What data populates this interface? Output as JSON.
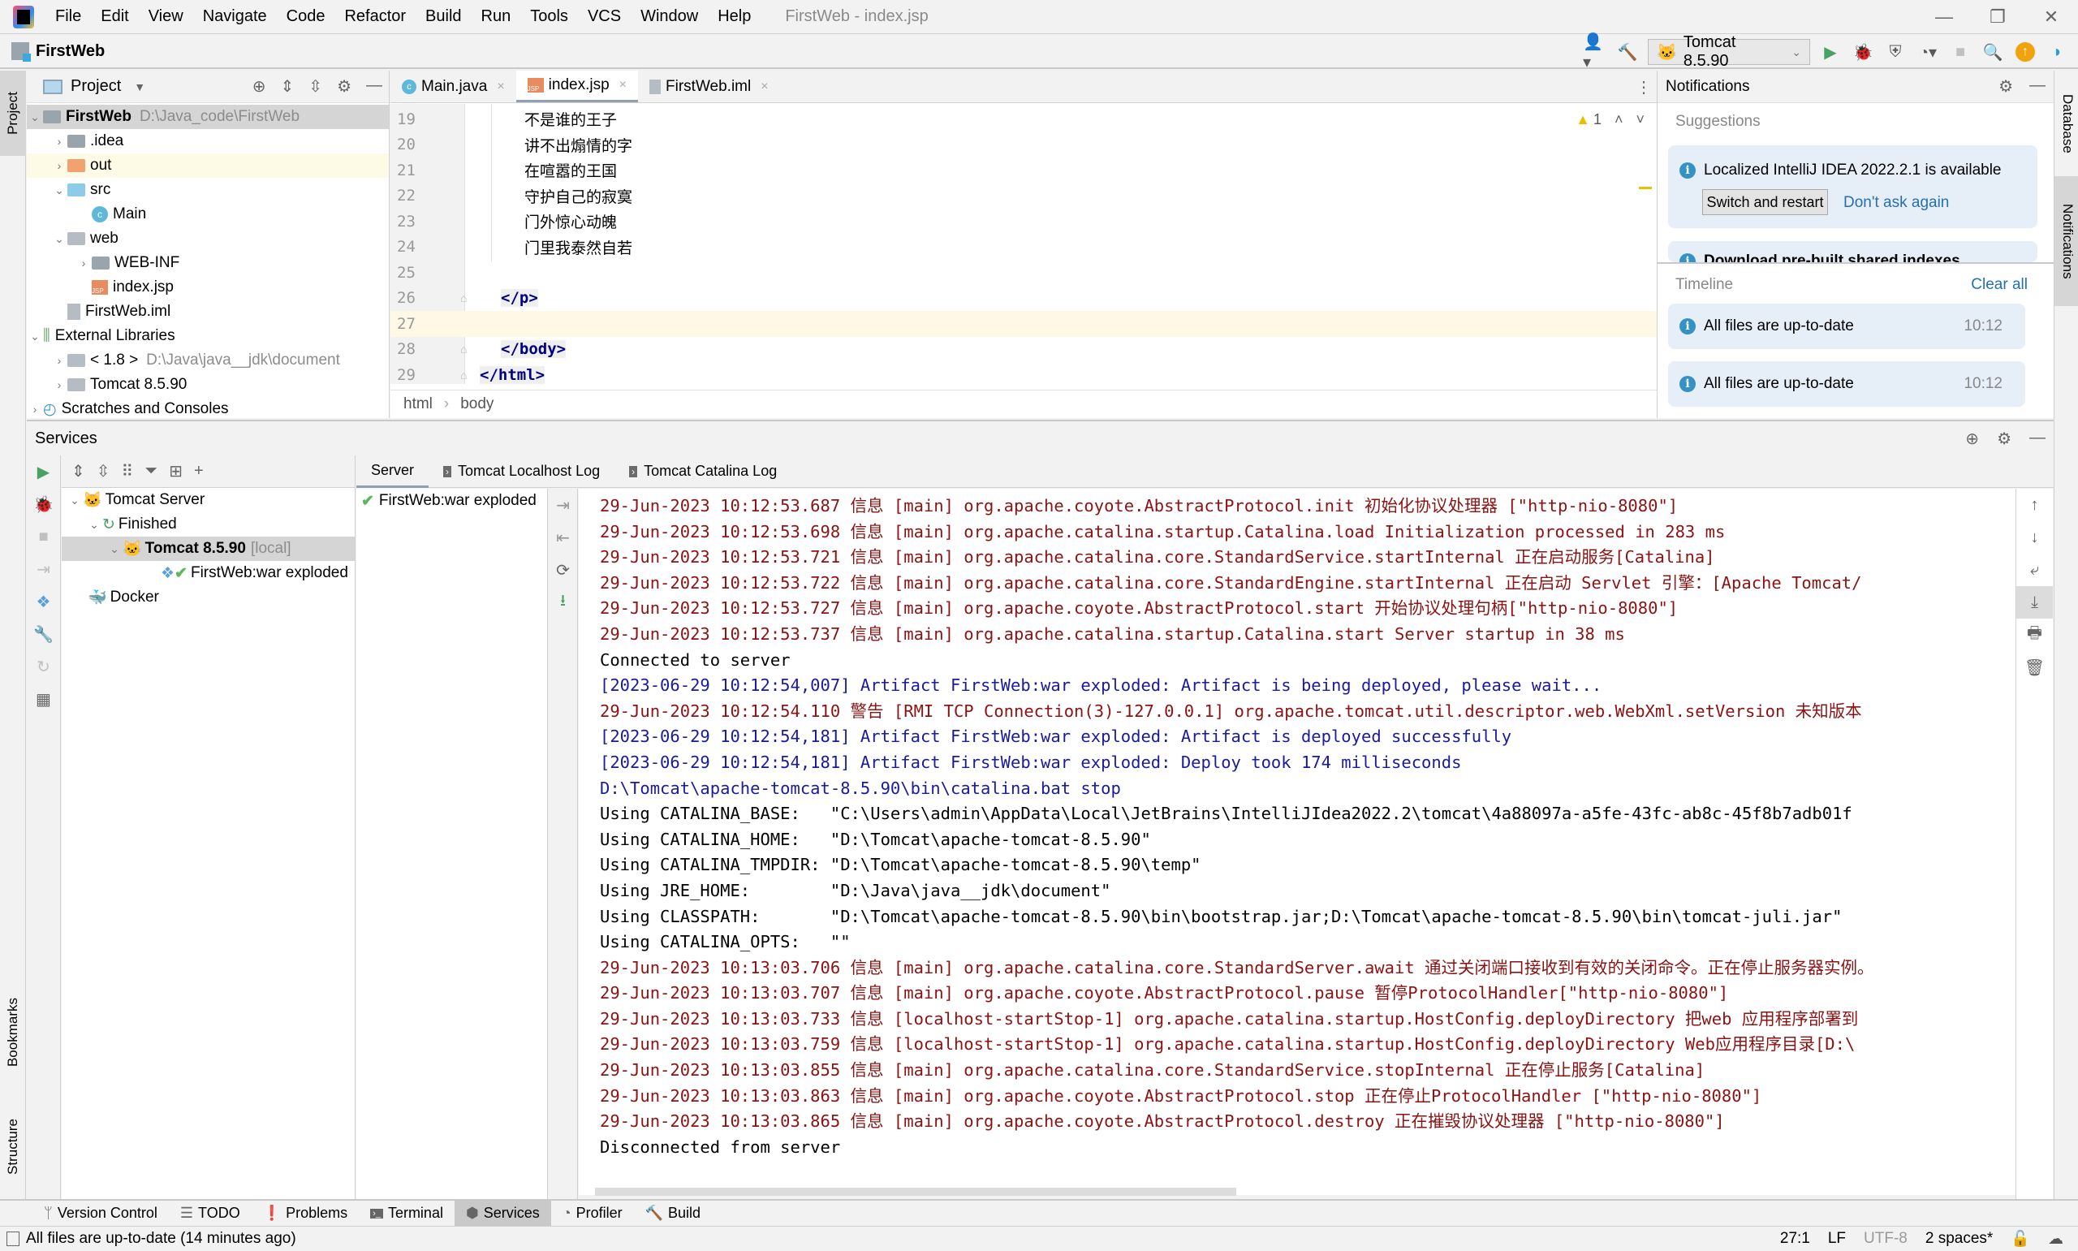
{
  "titlebar": {
    "menu": [
      "File",
      "Edit",
      "View",
      "Navigate",
      "Code",
      "Refactor",
      "Build",
      "Run",
      "Tools",
      "VCS",
      "Window",
      "Help"
    ],
    "window_title": "FirstWeb - index.jsp"
  },
  "navbar": {
    "project_name": "FirstWeb",
    "run_config": "Tomcat 8.5.90"
  },
  "left_stripe": {
    "project_tab": "Project",
    "bookmarks_tab": "Bookmarks",
    "structure_tab": "Structure"
  },
  "right_stripe": {
    "database_tab": "Database",
    "notifications_tab": "Notifications"
  },
  "project_panel": {
    "title": "Project",
    "tree": [
      {
        "label": "FirstWeb",
        "path": "D:\\Java_code\\FirstWeb"
      },
      {
        "label": ".idea"
      },
      {
        "label": "out"
      },
      {
        "label": "src"
      },
      {
        "label": "Main"
      },
      {
        "label": "web"
      },
      {
        "label": "WEB-INF"
      },
      {
        "label": "index.jsp"
      },
      {
        "label": "FirstWeb.iml"
      },
      {
        "label": "External Libraries"
      },
      {
        "label": "< 1.8 >",
        "path": "D:\\Java\\java__jdk\\document"
      },
      {
        "label": "Tomcat 8.5.90"
      },
      {
        "label": "Scratches and Consoles"
      }
    ]
  },
  "editor": {
    "tabs": [
      {
        "label": "Main.java"
      },
      {
        "label": "index.jsp",
        "active": true
      },
      {
        "label": "FirstWeb.iml"
      }
    ],
    "warning_count": "1",
    "lines": [
      {
        "num": "19",
        "text": "不是谁的王子"
      },
      {
        "num": "20",
        "text": "讲不出煽情的字"
      },
      {
        "num": "21",
        "text": "在喧嚣的王国"
      },
      {
        "num": "22",
        "text": "守护自己的寂寞"
      },
      {
        "num": "23",
        "text": "门外惊心动魄"
      },
      {
        "num": "24",
        "text": "门里我泰然自若"
      },
      {
        "num": "25",
        "text": ""
      },
      {
        "num": "26",
        "text": "</p>"
      },
      {
        "num": "27",
        "text": ""
      },
      {
        "num": "28",
        "text": "</body>"
      },
      {
        "num": "29",
        "text": "</html>"
      }
    ],
    "breadcrumb": [
      "html",
      "body"
    ]
  },
  "notifications": {
    "title": "Notifications",
    "suggestions_label": "Suggestions",
    "suggestion": {
      "text": "Localized IntelliJ IDEA 2022.2.1 is available",
      "primary_button": "Switch and restart",
      "secondary_link": "Don't ask again"
    },
    "suggestion2_partial": "Download pre-built shared indexes",
    "timeline_label": "Timeline",
    "clear_all": "Clear all",
    "timeline": [
      {
        "text": "All files are up-to-date",
        "time": "10:12"
      },
      {
        "text": "All files are up-to-date",
        "time": "10:12"
      }
    ]
  },
  "services": {
    "title": "Services",
    "tree": [
      {
        "label": "Tomcat Server"
      },
      {
        "label": "Finished"
      },
      {
        "label": "Tomcat 8.5.90",
        "suffix": "[local]"
      },
      {
        "label": "FirstWeb:war exploded"
      },
      {
        "label": "Docker"
      }
    ],
    "log_tabs": [
      "Server",
      "Tomcat Localhost Log",
      "Tomcat Catalina Log"
    ],
    "deployment": "FirstWeb:war exploded",
    "console": [
      {
        "c": "red",
        "t": "29-Jun-2023 10:12:53.687 信息 [main] org.apache.coyote.AbstractProtocol.init 初始化协议处理器 [\"http-nio-8080\"]"
      },
      {
        "c": "red",
        "t": "29-Jun-2023 10:12:53.698 信息 [main] org.apache.catalina.startup.Catalina.load Initialization processed in 283 ms"
      },
      {
        "c": "red",
        "t": "29-Jun-2023 10:12:53.721 信息 [main] org.apache.catalina.core.StandardService.startInternal 正在启动服务[Catalina]"
      },
      {
        "c": "red",
        "t": "29-Jun-2023 10:12:53.722 信息 [main] org.apache.catalina.core.StandardEngine.startInternal 正在启动 Servlet 引擎：[Apache Tomcat/"
      },
      {
        "c": "red",
        "t": "29-Jun-2023 10:12:53.727 信息 [main] org.apache.coyote.AbstractProtocol.start 开始协议处理句柄[\"http-nio-8080\"]"
      },
      {
        "c": "red",
        "t": "29-Jun-2023 10:12:53.737 信息 [main] org.apache.catalina.startup.Catalina.start Server startup in 38 ms"
      },
      {
        "c": "black",
        "t": "Connected to server"
      },
      {
        "c": "blue",
        "t": "[2023-06-29 10:12:54,007] Artifact FirstWeb:war exploded: Artifact is being deployed, please wait..."
      },
      {
        "c": "red",
        "t": "29-Jun-2023 10:12:54.110 警告 [RMI TCP Connection(3)-127.0.0.1] org.apache.tomcat.util.descriptor.web.WebXml.setVersion 未知版本"
      },
      {
        "c": "blue",
        "t": "[2023-06-29 10:12:54,181] Artifact FirstWeb:war exploded: Artifact is deployed successfully"
      },
      {
        "c": "blue",
        "t": "[2023-06-29 10:12:54,181] Artifact FirstWeb:war exploded: Deploy took 174 milliseconds"
      },
      {
        "c": "blue",
        "t": "D:\\Tomcat\\apache-tomcat-8.5.90\\bin\\catalina.bat stop"
      },
      {
        "c": "black",
        "t": "Using CATALINA_BASE:   \"C:\\Users\\admin\\AppData\\Local\\JetBrains\\IntelliJIdea2022.2\\tomcat\\4a88097a-a5fe-43fc-ab8c-45f8b7adb01f"
      },
      {
        "c": "black",
        "t": "Using CATALINA_HOME:   \"D:\\Tomcat\\apache-tomcat-8.5.90\""
      },
      {
        "c": "black",
        "t": "Using CATALINA_TMPDIR: \"D:\\Tomcat\\apache-tomcat-8.5.90\\temp\""
      },
      {
        "c": "black",
        "t": "Using JRE_HOME:        \"D:\\Java\\java__jdk\\document\""
      },
      {
        "c": "black",
        "t": "Using CLASSPATH:       \"D:\\Tomcat\\apache-tomcat-8.5.90\\bin\\bootstrap.jar;D:\\Tomcat\\apache-tomcat-8.5.90\\bin\\tomcat-juli.jar\""
      },
      {
        "c": "black",
        "t": "Using CATALINA_OPTS:   \"\""
      },
      {
        "c": "red",
        "t": "29-Jun-2023 10:13:03.706 信息 [main] org.apache.catalina.core.StandardServer.await 通过关闭端口接收到有效的关闭命令。正在停止服务器实例。"
      },
      {
        "c": "red",
        "t": "29-Jun-2023 10:13:03.707 信息 [main] org.apache.coyote.AbstractProtocol.pause 暂停ProtocolHandler[\"http-nio-8080\"]"
      },
      {
        "c": "red",
        "t": "29-Jun-2023 10:13:03.733 信息 [localhost-startStop-1] org.apache.catalina.startup.HostConfig.deployDirectory 把web 应用程序部署到"
      },
      {
        "c": "red",
        "t": "29-Jun-2023 10:13:03.759 信息 [localhost-startStop-1] org.apache.catalina.startup.HostConfig.deployDirectory Web应用程序目录[D:\\"
      },
      {
        "c": "red",
        "t": "29-Jun-2023 10:13:03.855 信息 [main] org.apache.catalina.core.StandardService.stopInternal 正在停止服务[Catalina]"
      },
      {
        "c": "red",
        "t": "29-Jun-2023 10:13:03.863 信息 [main] org.apache.coyote.AbstractProtocol.stop 正在停止ProtocolHandler [\"http-nio-8080\"]"
      },
      {
        "c": "red",
        "t": "29-Jun-2023 10:13:03.865 信息 [main] org.apache.coyote.AbstractProtocol.destroy 正在摧毁协议处理器 [\"http-nio-8080\"]"
      },
      {
        "c": "black",
        "t": "Disconnected from server"
      }
    ]
  },
  "tool_windows": [
    "Version Control",
    "TODO",
    "Problems",
    "Terminal",
    "Services",
    "Profiler",
    "Build"
  ],
  "status": {
    "message": "All files are up-to-date (14 minutes ago)",
    "position": "27:1",
    "line_sep": "LF",
    "encoding": "UTF-8",
    "indent": "2 spaces*"
  },
  "colors": {
    "log_info": "#8b1313",
    "log_artifact": "#1a1a9c",
    "accent_link": "#2470b3"
  }
}
